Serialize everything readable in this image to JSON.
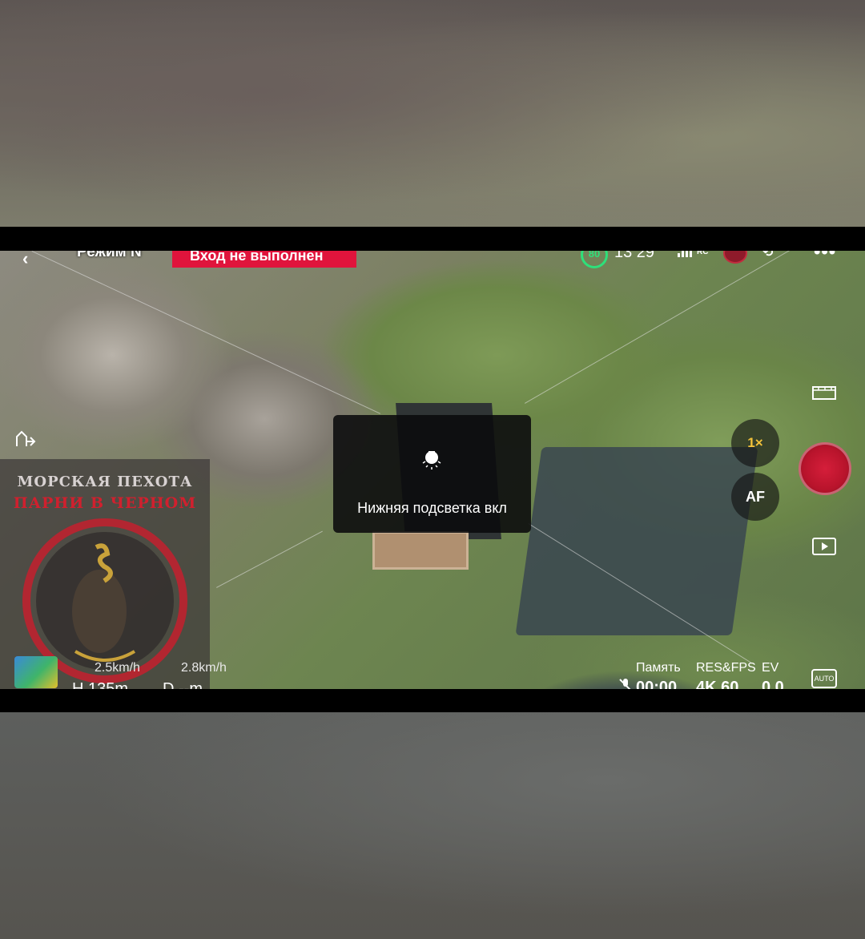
{
  "top_bar": {
    "mode_label": "Режим N",
    "login_status": "Вход не выполнен",
    "battery_percent": "80",
    "flight_time_left": "13 29",
    "rc_label": "RC",
    "colors": {
      "login_badge": "#e0143c",
      "battery": "#2ee07a"
    }
  },
  "toast": {
    "icon": "bulb-icon",
    "message": "Нижняя подсветка вкл"
  },
  "watermark": {
    "line1": "МОРСКАЯ ПЕХОТА",
    "line2": "ПАРНИ В ЧЕРНОМ"
  },
  "telemetry": {
    "horizontal_speed": "2.5km/h",
    "vertical_speed": "2.8km/h",
    "height": "H 135m",
    "distance": "D --m"
  },
  "camera_controls": {
    "zoom": "1×",
    "focus": "AF",
    "auto_label": "AUTO"
  },
  "bottom_info": {
    "memory_label": "Память",
    "memory_value": "00:00",
    "res_fps_label": "RES&FPS",
    "res_fps_value": "4K 60",
    "ev_label": "EV",
    "ev_value": "0.0"
  }
}
